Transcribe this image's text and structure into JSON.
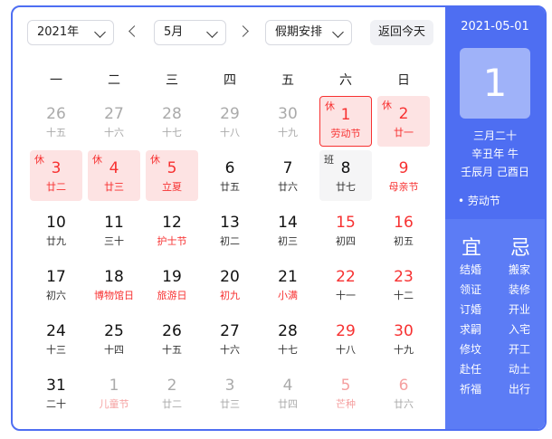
{
  "toolbar": {
    "year": "2021年",
    "month": "5月",
    "holiday": "假期安排",
    "today_label": "返回今天"
  },
  "weekdays": [
    "一",
    "二",
    "三",
    "四",
    "五",
    "六",
    "日"
  ],
  "days": [
    {
      "num": "26",
      "lunar": "十五",
      "other": true
    },
    {
      "num": "27",
      "lunar": "十六",
      "other": true
    },
    {
      "num": "28",
      "lunar": "十七",
      "other": true
    },
    {
      "num": "29",
      "lunar": "十八",
      "other": true
    },
    {
      "num": "30",
      "lunar": "十九",
      "other": true
    },
    {
      "num": "1",
      "lunar": "劳动节",
      "tag": "休",
      "holiday": true,
      "selected": true,
      "fest": true
    },
    {
      "num": "2",
      "lunar": "廿一",
      "tag": "休",
      "holiday": true
    },
    {
      "num": "3",
      "lunar": "廿二",
      "tag": "休",
      "holiday": true
    },
    {
      "num": "4",
      "lunar": "廿三",
      "tag": "休",
      "holiday": true
    },
    {
      "num": "5",
      "lunar": "立夏",
      "tag": "休",
      "holiday": true,
      "fest": true
    },
    {
      "num": "6",
      "lunar": "廿五"
    },
    {
      "num": "7",
      "lunar": "廿六"
    },
    {
      "num": "8",
      "lunar": "廿七",
      "tag": "班",
      "work": true
    },
    {
      "num": "9",
      "lunar": "母亲节",
      "weekend": true,
      "fest": true
    },
    {
      "num": "10",
      "lunar": "廿九"
    },
    {
      "num": "11",
      "lunar": "三十"
    },
    {
      "num": "12",
      "lunar": "护士节",
      "fest": true
    },
    {
      "num": "13",
      "lunar": "初二"
    },
    {
      "num": "14",
      "lunar": "初三"
    },
    {
      "num": "15",
      "lunar": "初四",
      "weekend": true
    },
    {
      "num": "16",
      "lunar": "初五",
      "weekend": true
    },
    {
      "num": "17",
      "lunar": "初六"
    },
    {
      "num": "18",
      "lunar": "博物馆日",
      "fest": true
    },
    {
      "num": "19",
      "lunar": "旅游日",
      "fest": true
    },
    {
      "num": "20",
      "lunar": "初九",
      "fest": true
    },
    {
      "num": "21",
      "lunar": "小满",
      "fest": true
    },
    {
      "num": "22",
      "lunar": "十一",
      "weekend": true
    },
    {
      "num": "23",
      "lunar": "十二",
      "weekend": true
    },
    {
      "num": "24",
      "lunar": "十三"
    },
    {
      "num": "25",
      "lunar": "十四"
    },
    {
      "num": "26",
      "lunar": "十五"
    },
    {
      "num": "27",
      "lunar": "十六"
    },
    {
      "num": "28",
      "lunar": "十七"
    },
    {
      "num": "29",
      "lunar": "十八",
      "weekend": true
    },
    {
      "num": "30",
      "lunar": "十九",
      "weekend": true
    },
    {
      "num": "31",
      "lunar": "二十"
    },
    {
      "num": "1",
      "lunar": "儿童节",
      "other": true,
      "fest": true
    },
    {
      "num": "2",
      "lunar": "廿二",
      "other": true
    },
    {
      "num": "3",
      "lunar": "廿三",
      "other": true
    },
    {
      "num": "4",
      "lunar": "廿四",
      "other": true
    },
    {
      "num": "5",
      "lunar": "芒种",
      "other": true,
      "weekend": true,
      "fest": true
    },
    {
      "num": "6",
      "lunar": "廿六",
      "other": true,
      "weekend": true
    }
  ],
  "side": {
    "date": "2021-05-01",
    "day": "1",
    "lunar_date": "三月二十",
    "ganzhi_year": "辛丑年 牛",
    "ganzhi_month_day": "壬辰月 己酉日",
    "festival": "• 劳动节",
    "yi_label": "宜",
    "ji_label": "忌",
    "yi": [
      "结婚",
      "领证",
      "订婚",
      "求嗣",
      "修坟",
      "赴任",
      "祈福"
    ],
    "ji": [
      "搬家",
      "装修",
      "开业",
      "入宅",
      "开工",
      "动土",
      "出行"
    ]
  },
  "colors": {
    "accent": "#4e6ef2",
    "holiday_bg": "#fde3e3",
    "red": "#f73131"
  }
}
